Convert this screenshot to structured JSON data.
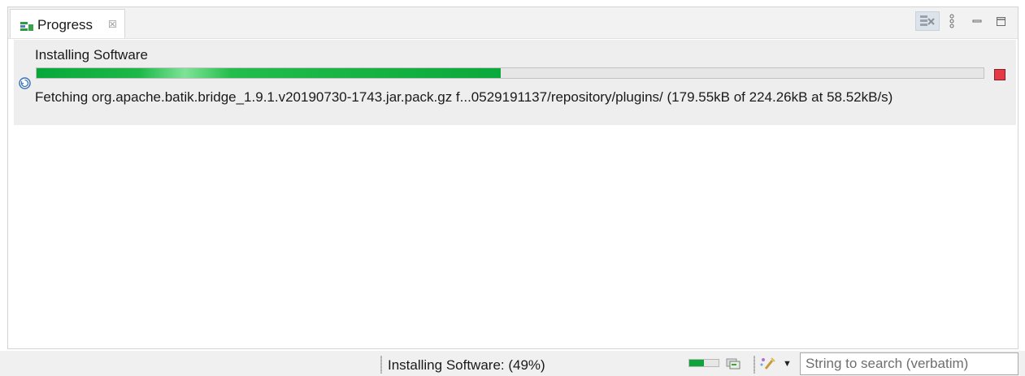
{
  "view": {
    "tab_label": "Progress",
    "tab_close": "☒"
  },
  "job": {
    "title": "Installing Software",
    "progress_fraction": 0.49,
    "detail": "Fetching org.apache.batik.bridge_1.9.1.v20190730-1743.jar.pack.gz f...0529191137/repository/plugins/ (179.55kB of 224.26kB at 58.52kB/s)"
  },
  "statusbar": {
    "text": "Installing Software: (49%)",
    "progress_fraction": 0.49,
    "search_placeholder": "String to search (verbatim)",
    "search_value": ""
  },
  "icons": {
    "tab": "progress-view-icon",
    "remove_all": "remove-all-finished-icon",
    "menu": "view-menu-icon",
    "minimize": "minimize-icon",
    "maximize": "maximize-icon",
    "job": "job-running-icon",
    "stop": "stop-icon",
    "console": "console-icon",
    "search": "search-tool-icon",
    "dropdown": "dropdown-arrow-icon"
  },
  "colors": {
    "progress_green": "#0aa93b",
    "stop_red": "#e53946",
    "job_background": "#eeeeee",
    "header_background": "#f2f2f2"
  }
}
